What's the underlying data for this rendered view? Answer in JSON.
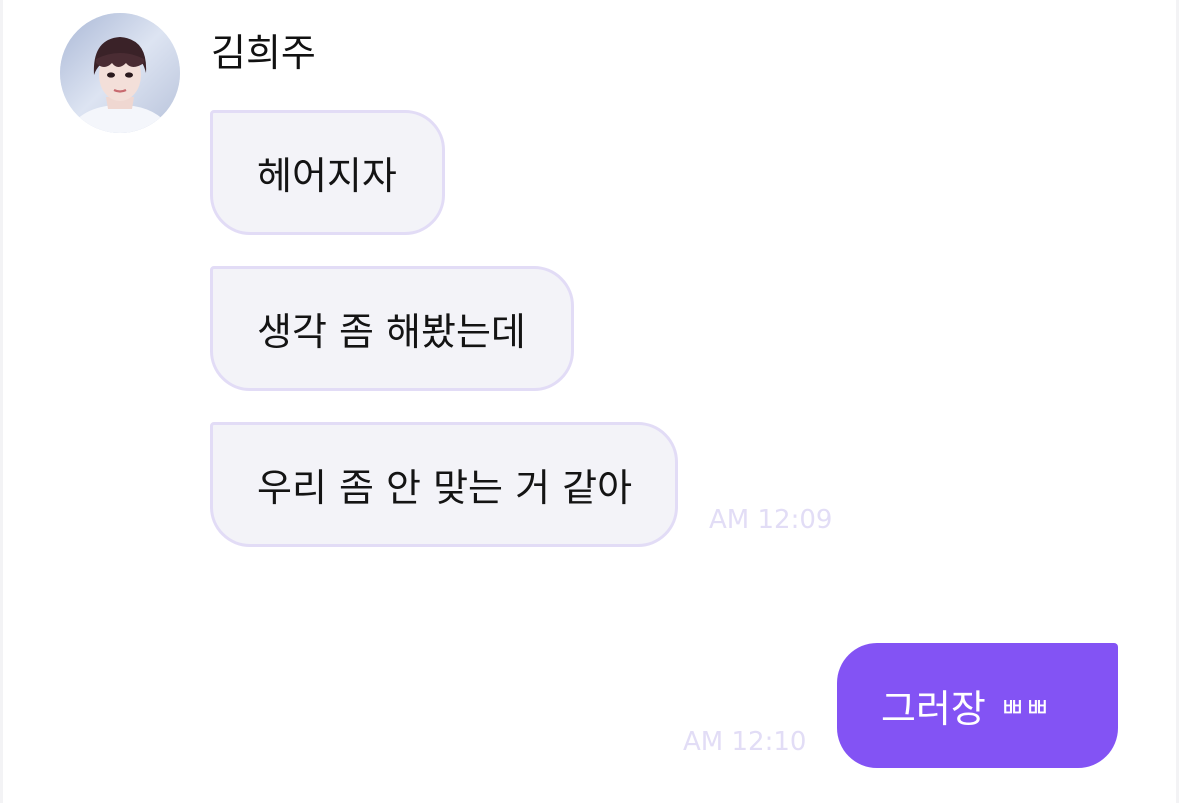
{
  "chat": {
    "sender_name": "김희주",
    "incoming_messages": [
      {
        "text": "헤어지자"
      },
      {
        "text": "생각 좀 해봤는데"
      },
      {
        "text": "우리 좀 안 맞는 거 같아"
      }
    ],
    "incoming_time": "AM 12:09",
    "outgoing_message": {
      "text": "그러장",
      "suffix": "ㅃㅃ"
    },
    "outgoing_time": "AM 12:10"
  },
  "colors": {
    "outgoing_bubble": "#8353f4",
    "incoming_bubble": "#f3f3f8",
    "incoming_border": "#e2dcf6",
    "timestamp": "#e2ddf6"
  },
  "icons": {
    "avatar": "profile-photo"
  }
}
